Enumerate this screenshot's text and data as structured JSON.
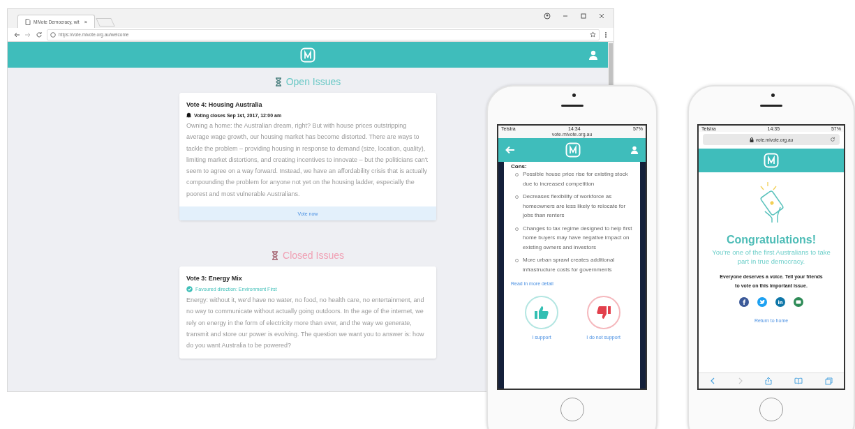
{
  "browser": {
    "tab_title": "MiVote Democracy, wit",
    "tab_close": "×",
    "url": "https://vote.mivote.org.au/welcome"
  },
  "sections": [
    {
      "kind": "open",
      "heading": "Open Issues",
      "cards": [
        {
          "title": "Vote 4: Housing Australia",
          "kind": "closing",
          "meta": "Voting closes Sep 1st, 2017, 12:00 am",
          "body": "Owning a home: the Australian dream, right? But with house prices outstripping average wage growth, our housing market has become distorted. There are ways to tackle the problem – providing housing in response to demand (size, location, quality), limiting market distortions, and creating incentives to innovate – but the politicians can't seem to agree on a way forward. Instead, we have an affordability crisis that is actually compounding the problem for anyone not yet on the housing ladder, especially the poorest and most vulnerable Australians.",
          "action": "Vote now"
        }
      ]
    },
    {
      "kind": "closed",
      "heading": "Closed Issues",
      "cards": [
        {
          "title": "Vote 3: Energy Mix",
          "kind": "result",
          "meta": "Favoured direction: Environment First",
          "body": "Energy: without it, we'd have no water, no food, no health care, no entertainment, and no way to communicate without actually going outdoors. In the age of the internet, we rely on energy in the form of electricity more than ever, and the way we generate, transmit and store our power is evolving. The question we want you to answer is: how do you want Australia to be powered?"
        }
      ]
    }
  ],
  "phone_detail": {
    "status": {
      "carrier": "Telstra",
      "time": "14:34",
      "battery": "57%"
    },
    "url": "vote.mivote.org.au",
    "section_heading": "Cons:",
    "points": [
      "Possible house price rise for existing stock due to increased competition",
      "Decreases flexibility of workforce as homeowners are less likely to relocate for jobs than renters",
      "Changes to tax regime designed to help first home buyers may have negative impact on existing owners and investors",
      "More urban sprawl creates additional infrastructure costs for governments"
    ],
    "link": "Read in more detail",
    "choices": [
      {
        "kind": "support",
        "label": "I support"
      },
      {
        "kind": "oppose",
        "label": "I do not support"
      }
    ]
  },
  "phone_share": {
    "status": {
      "carrier": "Telstra",
      "time": "14:35",
      "battery": "57%"
    },
    "url": "vote.mivote.org.au",
    "heading": "Congratulations!",
    "subheading": "You're one of the first Australians to take part in true democracy.",
    "message": "Everyone deserves a voice. Tell your friends to vote on this important issue.",
    "share_buttons": [
      {
        "kind": "facebook",
        "color": "#3b5998"
      },
      {
        "kind": "twitter",
        "color": "#1da1f2"
      },
      {
        "kind": "linkedin",
        "color": "#0e76a8"
      },
      {
        "kind": "email",
        "color": "#2e8b57"
      }
    ],
    "link": "Return to home"
  }
}
